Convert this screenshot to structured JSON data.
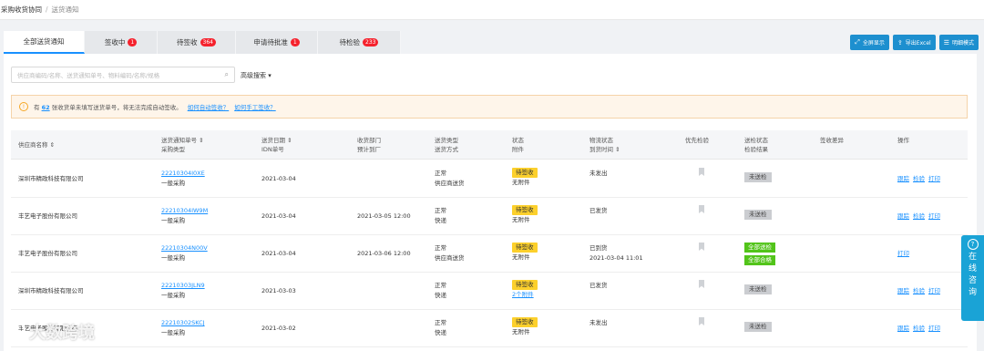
{
  "breadcrumb": {
    "items": [
      "采购收货协同",
      "送货通知"
    ]
  },
  "tabs": [
    {
      "label": "全部送货通知",
      "badge": null,
      "active": true
    },
    {
      "label": "签收中",
      "badge": "1"
    },
    {
      "label": "待签收",
      "badge": "364"
    },
    {
      "label": "申请待批准",
      "badge": "1"
    },
    {
      "label": "待检验",
      "badge": "233"
    }
  ],
  "toolbar": {
    "fullscreen": "全屏显示",
    "export": "导出Excel",
    "detail_mode": "明细模式"
  },
  "search": {
    "placeholder": "供应商编码/名称、送货通知单号、物料编码/名称/规格",
    "advanced": "高级搜索"
  },
  "notice": {
    "prefix": "有",
    "count": "62",
    "text": "张收货单未填写送货单号，将无法完成自动签收。",
    "link1": "如何自动签收？",
    "link2": "如何手工签收？"
  },
  "columns": {
    "supplier": "供应商名称",
    "notice_no": "送货通知单号",
    "purchase_type": "采购类型",
    "ship_date": "送货日期",
    "idn": "IDN单号",
    "dept": "收货部门",
    "eta": "预计到厂",
    "ship_type": "送货类型",
    "ship_mode": "送货方式",
    "status": "状态",
    "attach": "附件",
    "logistics": "物流状态",
    "arrive": "到货时间",
    "priority": "优先检验",
    "inspect_status": "送检状态",
    "inspect_result": "检验结果",
    "sign_diff": "签收差异",
    "ops": "操作"
  },
  "rows": [
    {
      "supplier": "深圳市精政科技有限公司",
      "notice_no": "22210304I0XE",
      "purchase_type": "一般采购",
      "ship_date": "2021-03-04",
      "eta": "",
      "ship_type": "正常",
      "ship_mode": "供应商送货",
      "status": "待签收",
      "attach": "无附件",
      "logistics": "未发出",
      "arrive": "",
      "inspect": [
        "未送检"
      ],
      "ops": [
        "跟踪",
        "检验",
        "打印"
      ]
    },
    {
      "supplier": "丰艺电子股份有限公司",
      "notice_no": "22210304IW9M",
      "purchase_type": "一般采购",
      "ship_date": "2021-03-04",
      "eta": "2021-03-05 12:00",
      "ship_type": "正常",
      "ship_mode": "快递",
      "status": "待签收",
      "attach": "无附件",
      "logistics": "已发货",
      "arrive": "",
      "inspect": [
        "未送检"
      ],
      "ops": [
        "跟踪",
        "检验",
        "打印"
      ]
    },
    {
      "supplier": "丰艺电子股份有限公司",
      "notice_no": "22210304N00V",
      "purchase_type": "一般采购",
      "ship_date": "2021-03-04",
      "eta": "2021-03-06 12:00",
      "ship_type": "正常",
      "ship_mode": "供应商送货",
      "status": "待签收",
      "attach": "无附件",
      "logistics": "已到货",
      "arrive": "2021-03-04 11:01",
      "inspect": [
        "全部送检",
        "全部合格"
      ],
      "ops": [
        "打印"
      ]
    },
    {
      "supplier": "深圳市精政科技有限公司",
      "notice_no": "22210303JLN9",
      "purchase_type": "一般采购",
      "ship_date": "2021-03-03",
      "eta": "",
      "ship_type": "正常",
      "ship_mode": "快递",
      "status": "待签收",
      "attach": "2个附件",
      "logistics": "已发货",
      "arrive": "",
      "inspect": [
        "未送检"
      ],
      "ops": [
        "跟踪",
        "检验",
        "打印"
      ]
    },
    {
      "supplier": "丰艺电子股份有限公司",
      "notice_no": "22210302SKCJ",
      "purchase_type": "一般采购",
      "ship_date": "2021-03-02",
      "eta": "",
      "ship_type": "正常",
      "ship_mode": "快递",
      "status": "待签收",
      "attach": "无附件",
      "logistics": "未发出",
      "arrive": "",
      "inspect": [
        "未送检"
      ],
      "ops": [
        "跟踪",
        "检验",
        "打印"
      ]
    }
  ],
  "float_help": {
    "chars": [
      "在",
      "线",
      "咨",
      "询"
    ]
  },
  "watermark": "大数跨境",
  "colors": {
    "accent": "#1890ff",
    "button": "#1d8fcf",
    "badge": "#f5222d",
    "status_pending": "#fcd02c",
    "status_grey": "#cbcdd1",
    "status_green": "#52c41a"
  }
}
